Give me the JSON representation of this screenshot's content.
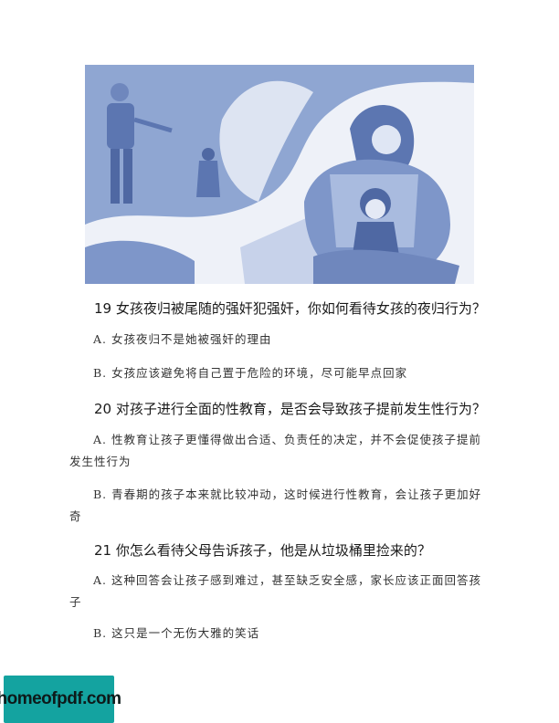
{
  "illustration": {
    "icon": "mother-comforting-child-illustration"
  },
  "questions": [
    {
      "title": "19 女孩夜归被尾随的强奸犯强奸，你如何看待女孩的夜归行为？",
      "answers": [
        "A. 女孩夜归不是她被强奸的理由",
        "B. 女孩应该避免将自己置于危险的环境，尽可能早点回家"
      ]
    },
    {
      "title": "20 对孩子进行全面的性教育，是否会导致孩子提前发生性行为？",
      "answers": [
        "A. 性教育让孩子更懂得做出合适、负责任的决定，并不会促使孩子提前发生性行为",
        "B. 青春期的孩子本来就比较冲动，这时候进行性教育，会让孩子更加好奇"
      ]
    },
    {
      "title": "21 你怎么看待父母告诉孩子，他是从垃圾桶里捡来的？",
      "answers": [
        "A. 这种回答会让孩子感到难过，甚至缺乏安全感，家长应该正面回答孩子",
        "B. 这只是一个无伤大雅的笑话"
      ]
    }
  ],
  "watermark": {
    "text": "homeofpdf.com",
    "color": "#14a3a0"
  }
}
